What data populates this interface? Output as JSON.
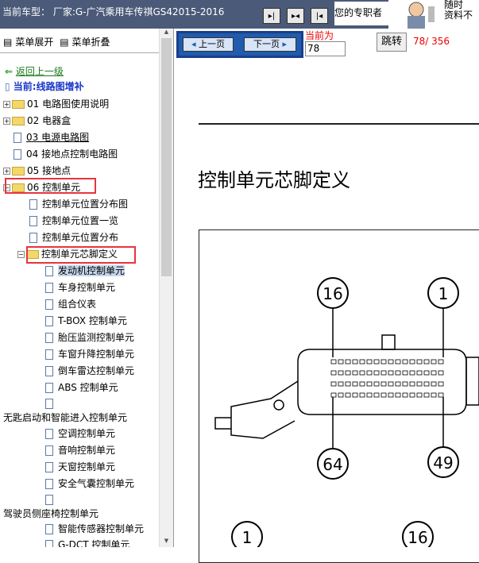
{
  "window": {
    "car_model_line": "当前车型： 厂家:G-广汽乘用车传祺GS42015-2016"
  },
  "toolbar": {
    "promo_text": "您的专职者",
    "promo_text2": "随时\n资料不"
  },
  "sidebar": {
    "expand_all": "菜单展开",
    "collapse_all": "菜单折叠",
    "back": "返回上一级",
    "current": "当前:线路图增补",
    "items": [
      {
        "label": "01 电路图使用说明"
      },
      {
        "label": "02 电器盒"
      },
      {
        "label": "03 电源电路图"
      },
      {
        "label": "04 接地点控制电路图"
      },
      {
        "label": "05 接地点"
      },
      {
        "label": "06 控制单元"
      },
      {
        "label": "控制单元位置分布图"
      },
      {
        "label": "控制单元位置一览"
      },
      {
        "label": "控制单元位置分布"
      },
      {
        "label": "控制单元芯脚定义"
      },
      {
        "label": "发动机控制单元"
      },
      {
        "label": "车身控制单元"
      },
      {
        "label": "组合仪表"
      },
      {
        "label": "T-BOX 控制单元"
      },
      {
        "label": "胎压监测控制单元"
      },
      {
        "label": "车窗升降控制单元"
      },
      {
        "label": "倒车雷达控制单元"
      },
      {
        "label": "ABS 控制单元"
      },
      {
        "label": "无匙启动和智能进入控制单元"
      },
      {
        "label": "空调控制单元"
      },
      {
        "label": "音响控制单元"
      },
      {
        "label": "天窗控制单元"
      },
      {
        "label": "安全气囊控制单元"
      },
      {
        "label": "驾驶员侧座椅控制单元"
      },
      {
        "label": "智能传感器控制单元"
      },
      {
        "label": "G-DCT 控制单元"
      }
    ]
  },
  "pager": {
    "prev": "上一页",
    "next": "下一页",
    "current_label": "当前为",
    "current_page": "78",
    "jump": "跳转",
    "page_count": "78/ 356"
  },
  "document": {
    "heading": "控制单元芯脚定义",
    "callouts": [
      "16",
      "1",
      "64",
      "49",
      "1",
      "16"
    ]
  }
}
